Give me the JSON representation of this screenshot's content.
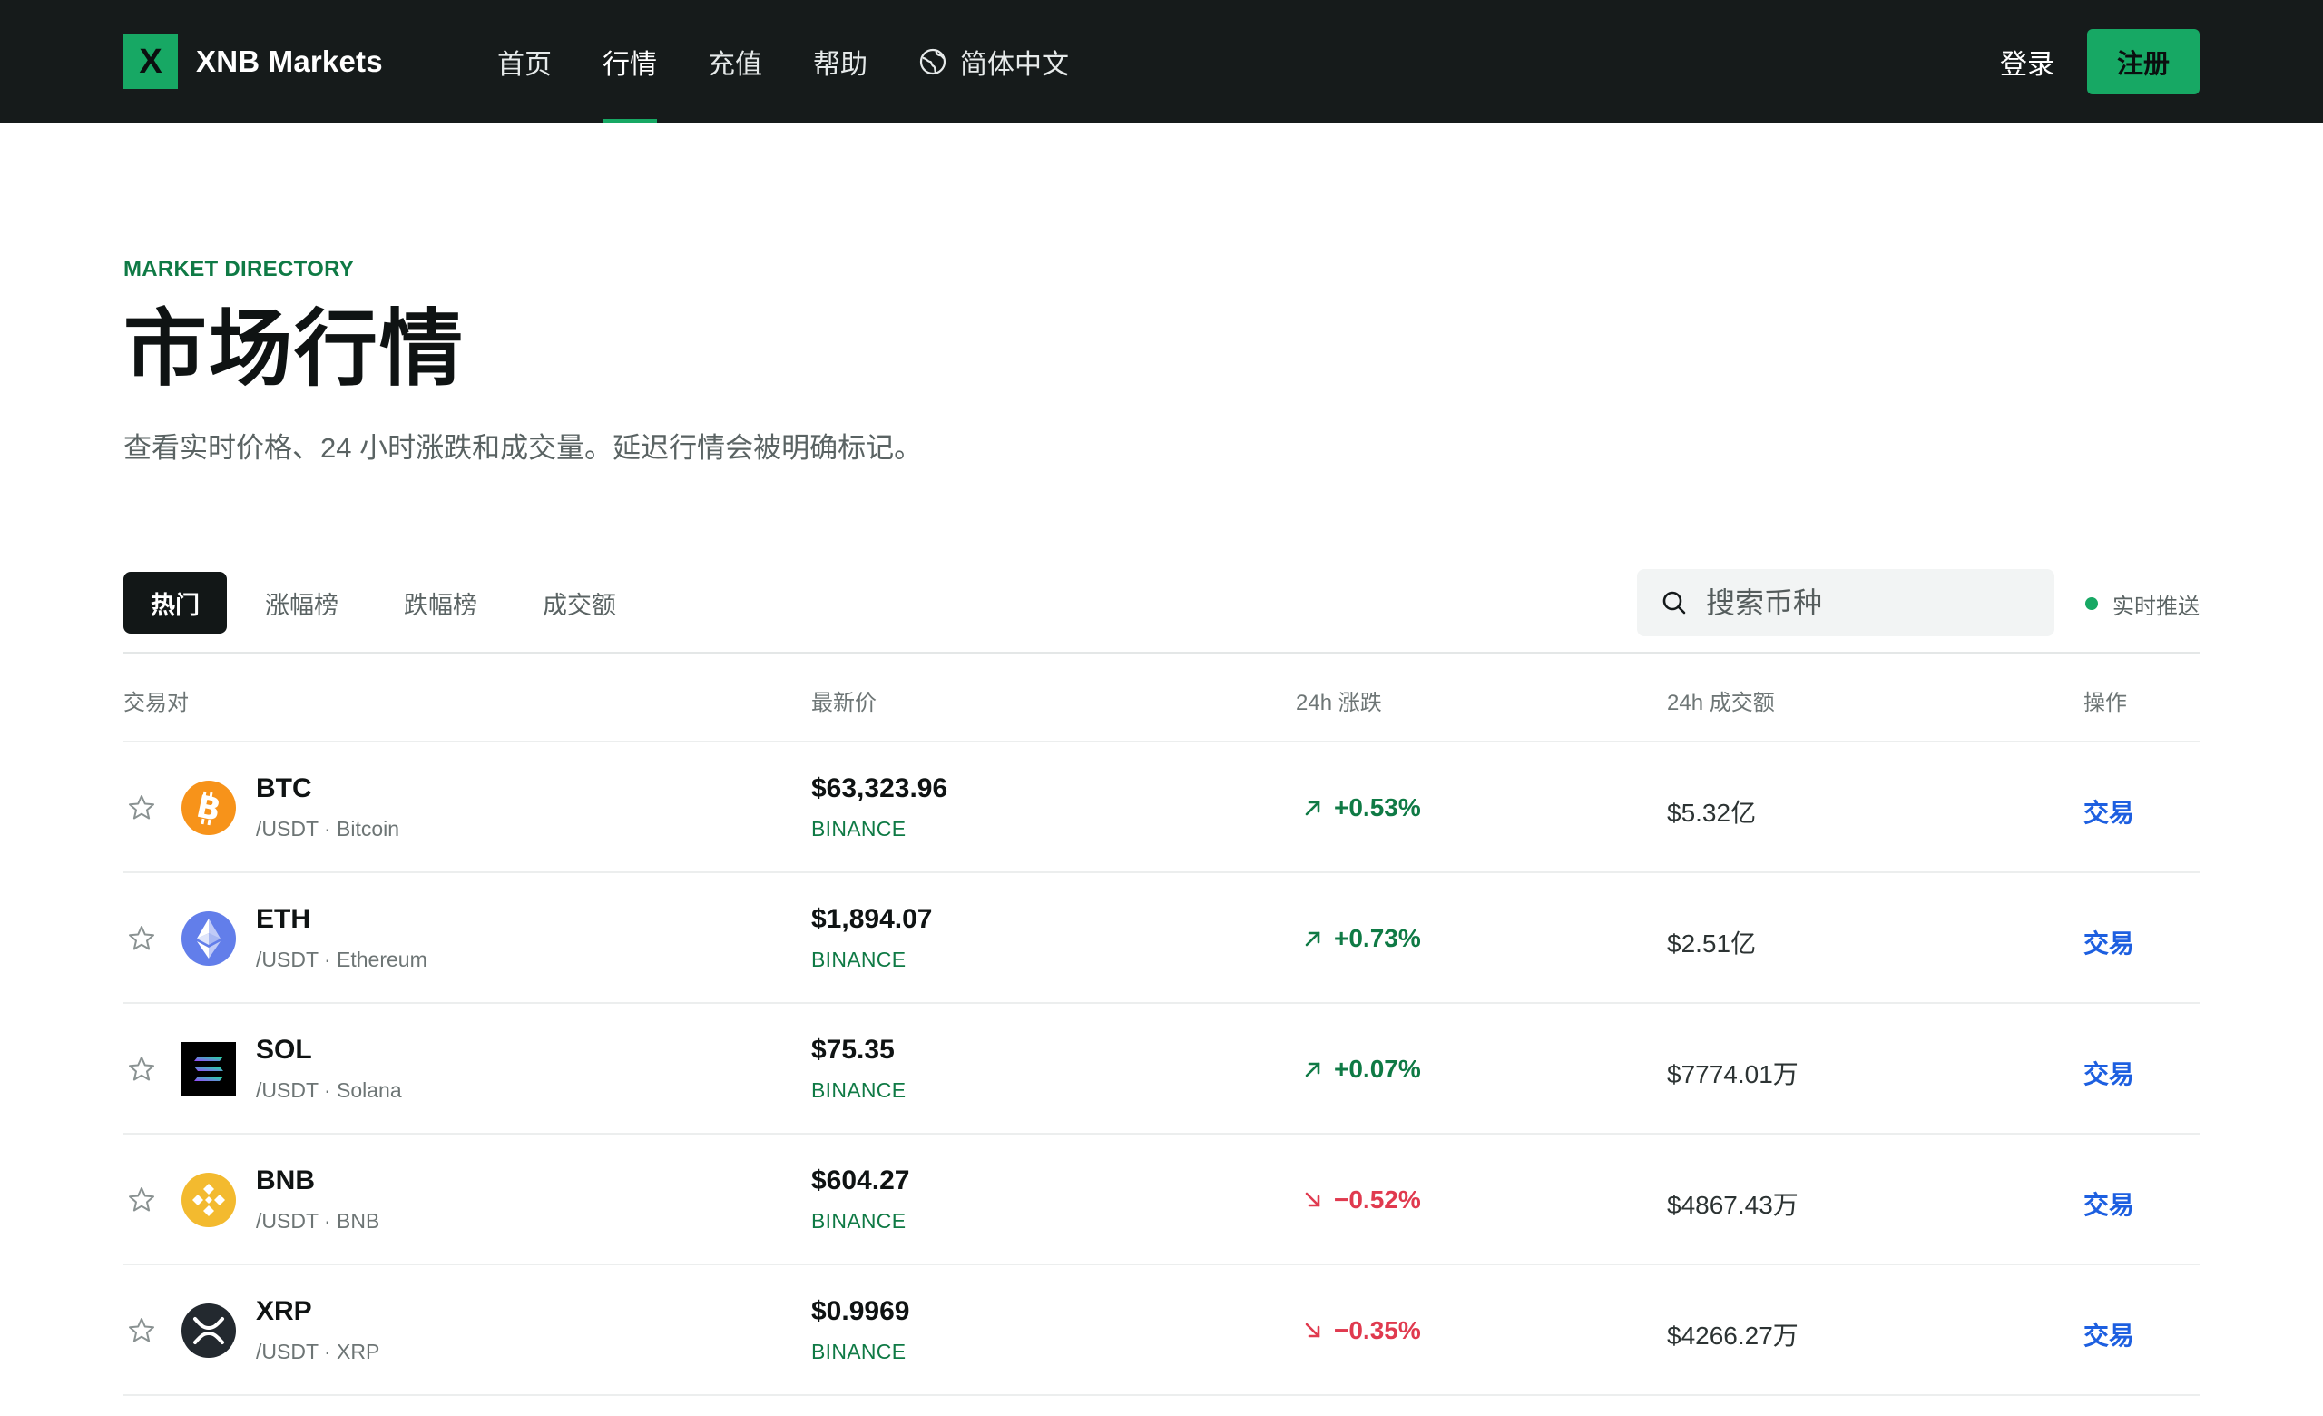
{
  "nav": {
    "logo_mark": "X",
    "brand": "XNB Markets",
    "links": [
      "首页",
      "行情",
      "充值",
      "帮助"
    ],
    "active_index": 1,
    "language": "简体中文",
    "login": "登录",
    "register": "注册"
  },
  "hero": {
    "eyebrow": "MARKET DIRECTORY",
    "title": "市场行情",
    "subtitle": "查看实时价格、24 小时涨跌和成交量。延迟行情会被明确标记。"
  },
  "tabs": [
    "热门",
    "涨幅榜",
    "跌幅榜",
    "成交额"
  ],
  "active_tab": 0,
  "search": {
    "placeholder": "搜索币种"
  },
  "live_label": "实时推送",
  "table": {
    "headers": {
      "pair": "交易对",
      "price": "最新价",
      "change": "24h 涨跌",
      "volume": "24h 成交额",
      "action": "操作"
    },
    "rows": [
      {
        "symbol": "BTC",
        "sub": "/USDT · Bitcoin",
        "price": "$63,323.96",
        "exchange": "BINANCE",
        "change": "+0.53%",
        "direction": "up",
        "volume": "$5.32亿",
        "action": "交易",
        "icon": "bitcoin-icon",
        "color": "#f7931a"
      },
      {
        "symbol": "ETH",
        "sub": "/USDT · Ethereum",
        "price": "$1,894.07",
        "exchange": "BINANCE",
        "change": "+0.73%",
        "direction": "up",
        "volume": "$2.51亿",
        "action": "交易",
        "icon": "ethereum-icon",
        "color": "#627eea"
      },
      {
        "symbol": "SOL",
        "sub": "/USDT · Solana",
        "price": "$75.35",
        "exchange": "BINANCE",
        "change": "+0.07%",
        "direction": "up",
        "volume": "$7774.01万",
        "action": "交易",
        "icon": "solana-icon",
        "color": "#000000"
      },
      {
        "symbol": "BNB",
        "sub": "/USDT · BNB",
        "price": "$604.27",
        "exchange": "BINANCE",
        "change": "−0.52%",
        "direction": "down",
        "volume": "$4867.43万",
        "action": "交易",
        "icon": "bnb-icon",
        "color": "#f3ba2f"
      },
      {
        "symbol": "XRP",
        "sub": "/USDT · XRP",
        "price": "$0.9969",
        "exchange": "BINANCE",
        "change": "−0.35%",
        "direction": "down",
        "volume": "$4266.27万",
        "action": "交易",
        "icon": "xrp-icon",
        "color": "#23292f"
      }
    ]
  },
  "colors": {
    "nav_bg": "#161b1b",
    "accent": "#17a864",
    "up": "#0f7a45",
    "down": "#e03a4f",
    "link": "#1d5fe0"
  }
}
